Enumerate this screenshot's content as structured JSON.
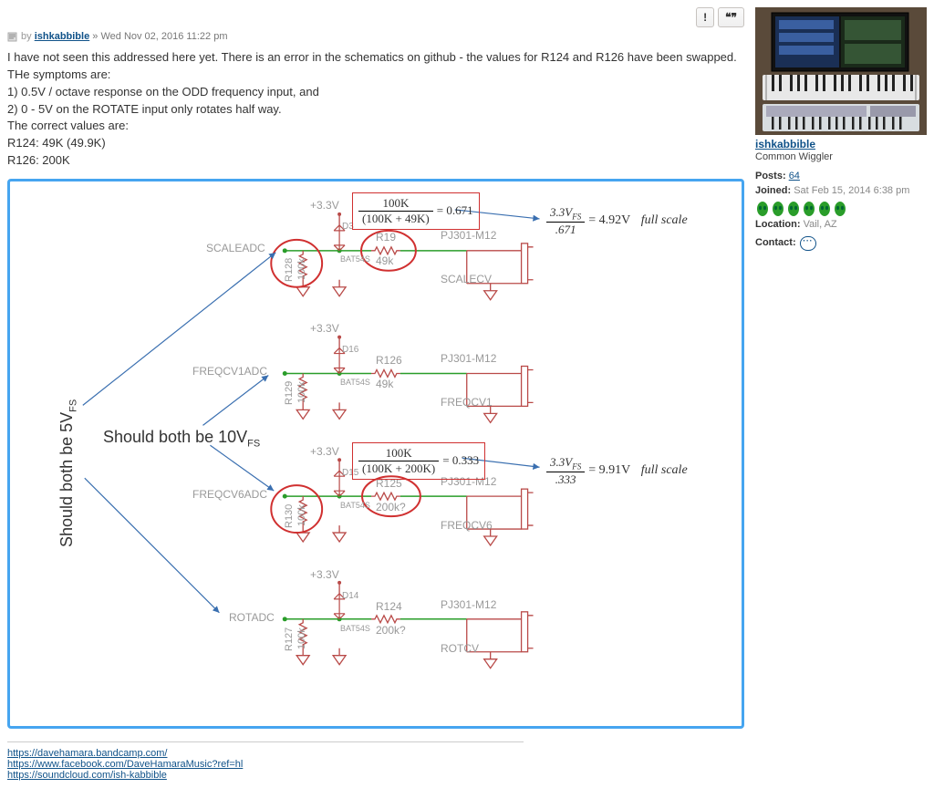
{
  "buttons": {
    "report": "!",
    "quote": "❝❞"
  },
  "meta": {
    "by": "by",
    "author": "ishkabbible",
    "sep": "»",
    "date": "Wed Nov 02, 2016 11:22 pm"
  },
  "body": {
    "l1": "I have not seen this addressed here yet. There is an error in the schematics on github - the values for R124 and R126 have been swapped. THe symptoms are:",
    "l2": "1) 0.5V / octave response on the ODD frequency input, and",
    "l3": "2) 0 - 5V on the ROTATE input only rotates half way.",
    "l4": "The correct values are:",
    "l5": "R124: 49K (49.9K)",
    "l6": "R126: 200K"
  },
  "schem": {
    "v33": "+3.3V",
    "scaleadc": "SCALEADC",
    "freqcv1adc": "FREQCV1ADC",
    "freqcv6adc": "FREQCV6ADC",
    "rotadc": "ROTADC",
    "scalecv": "SCALECV",
    "freqcv1": "FREQCV1",
    "freqcv6": "FREQCV6",
    "rotcv": "ROTCV",
    "pj": "PJ301-M12",
    "r19": "R19",
    "r19v": "49k",
    "r126": "R126",
    "r126v": "49k",
    "r125": "R125",
    "r125v": "200k?",
    "r124": "R124",
    "r124v": "200k?",
    "r128": "R128",
    "r129": "R129",
    "r130": "R130",
    "r127": "R127",
    "r100k": "100k",
    "d3": "D3",
    "d16": "D16",
    "d15": "D15",
    "d14": "D14",
    "bat": "BAT54S",
    "eq1n": "100K",
    "eq1d": "(100K + 49K)",
    "eq1r": "= 0.671",
    "eq2n": "100K",
    "eq2d": "(100K + 200K)",
    "eq2r": "= 0.333",
    "fs1n": "3.3V",
    "fs1sub": "FS",
    "fs1d": ".671",
    "fs1eq": "= 4.92V",
    "fs1tail": "full scale",
    "fs2n": "3.3V",
    "fs2d": ".333",
    "fs2eq": "= 9.91V",
    "fs2tail": "full scale",
    "left_label": "Should both be 5V",
    "left_sub": "FS",
    "mid_label": "Should both be 10V",
    "mid_sub": "FS"
  },
  "sig": {
    "u1": "https://davehamara.bandcamp.com/",
    "u2": "https://www.facebook.com/DaveHamaraMusic?ref=hl",
    "u3": "https://soundcloud.com/ish-kabbible"
  },
  "profile": {
    "name": "ishkabbible",
    "rank": "Common Wiggler",
    "posts_l": "Posts:",
    "posts": "64",
    "joined_l": "Joined:",
    "joined": "Sat Feb 15, 2014 6:38 pm",
    "loc_l": "Location:",
    "loc": "Vail, AZ",
    "contact_l": "Contact:"
  }
}
